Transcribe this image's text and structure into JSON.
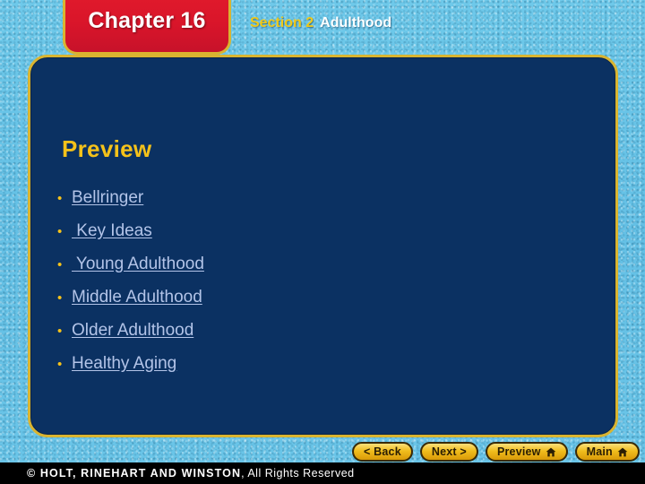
{
  "header": {
    "chapter_label": "Chapter 16",
    "section_label": "Section 2",
    "section_topic": "Adulthood"
  },
  "panel": {
    "heading": "Preview",
    "links": [
      {
        "label": "Bellringer"
      },
      {
        "label": " Key Ideas"
      },
      {
        "label": " Young Adulthood"
      },
      {
        "label": "Middle Adulthood"
      },
      {
        "label": "Older Adulthood"
      },
      {
        "label": "Healthy Aging"
      }
    ],
    "bullet_glyph": "•"
  },
  "navigation": {
    "back_label": "< Back",
    "next_label": "Next >",
    "preview_label": "Preview",
    "main_label": "Main"
  },
  "footer": {
    "publisher": "© HOLT, RINEHART AND WINSTON",
    "rights": ", All Rights Reserved"
  },
  "colors": {
    "backdrop": "#68c4e8",
    "panel_fill": "#0b3162",
    "panel_border": "#d9b430",
    "chapter_tab": "#d9152a",
    "accent_gold": "#f5c21a",
    "link": "#b3c4e8",
    "footer_bar": "#000000"
  }
}
